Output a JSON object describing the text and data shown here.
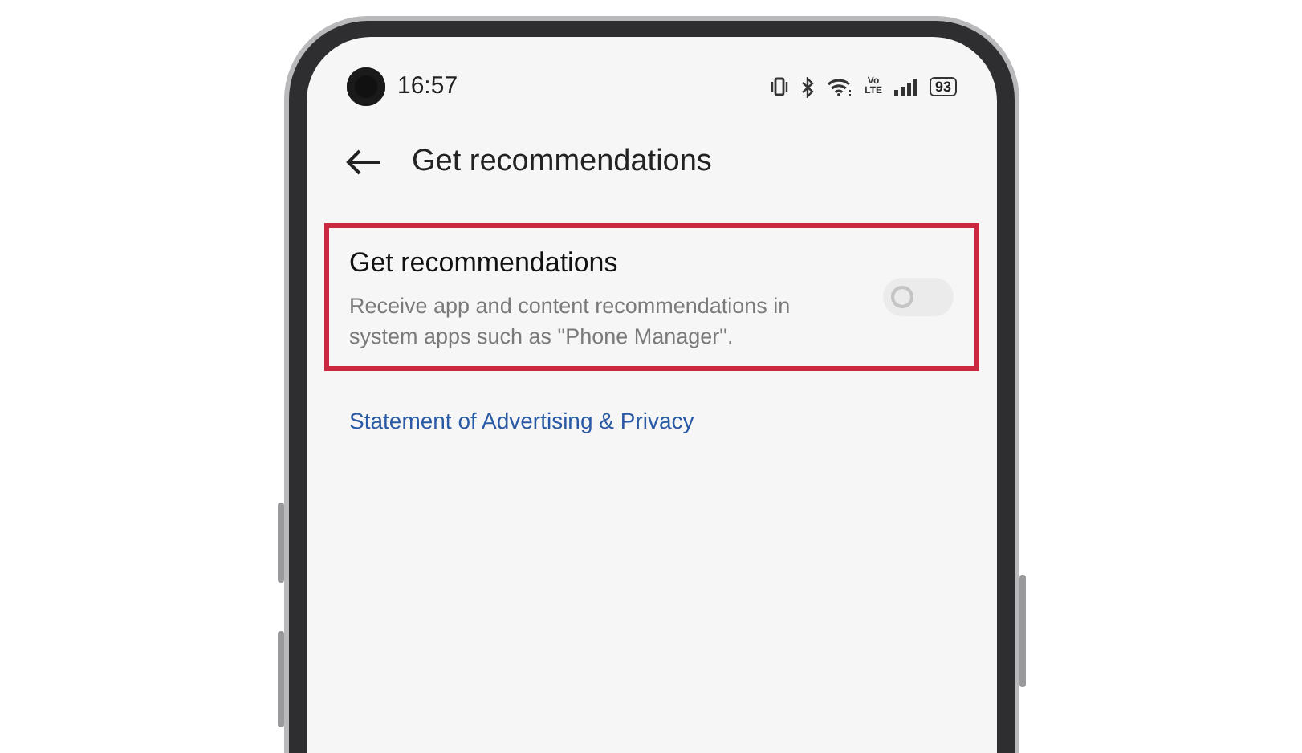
{
  "status_bar": {
    "time": "16:57",
    "network_label": [
      "Vo",
      "LTE"
    ],
    "battery": "93"
  },
  "header": {
    "title": "Get recommendations"
  },
  "setting": {
    "title": "Get recommendations",
    "description": "Receive app and content recommendations in system apps such as \"Phone Manager\".",
    "on": false,
    "disabled": true,
    "highlighted": true
  },
  "link": "Statement of Advertising & Privacy"
}
